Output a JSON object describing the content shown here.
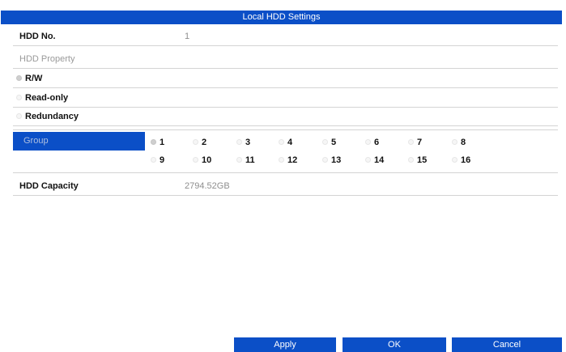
{
  "dialog": {
    "title": "Local HDD Settings"
  },
  "hdd_no": {
    "label": "HDD No.",
    "value": "1"
  },
  "hdd_property": {
    "label": "HDD Property",
    "options": [
      {
        "label": "R/W",
        "checked": true
      },
      {
        "label": "Read-only",
        "checked": false
      },
      {
        "label": "Redundancy",
        "checked": false
      }
    ]
  },
  "group": {
    "label": "Group",
    "options": [
      "1",
      "2",
      "3",
      "4",
      "5",
      "6",
      "7",
      "8",
      "9",
      "10",
      "11",
      "12",
      "13",
      "14",
      "15",
      "16"
    ],
    "selected": "1"
  },
  "hdd_capacity": {
    "label": "HDD Capacity",
    "value": "2794.52GB"
  },
  "buttons": {
    "apply": "Apply",
    "ok": "OK",
    "cancel": "Cancel"
  },
  "colors": {
    "accent": "#0b4fc7",
    "title_text": "#ffffff"
  }
}
